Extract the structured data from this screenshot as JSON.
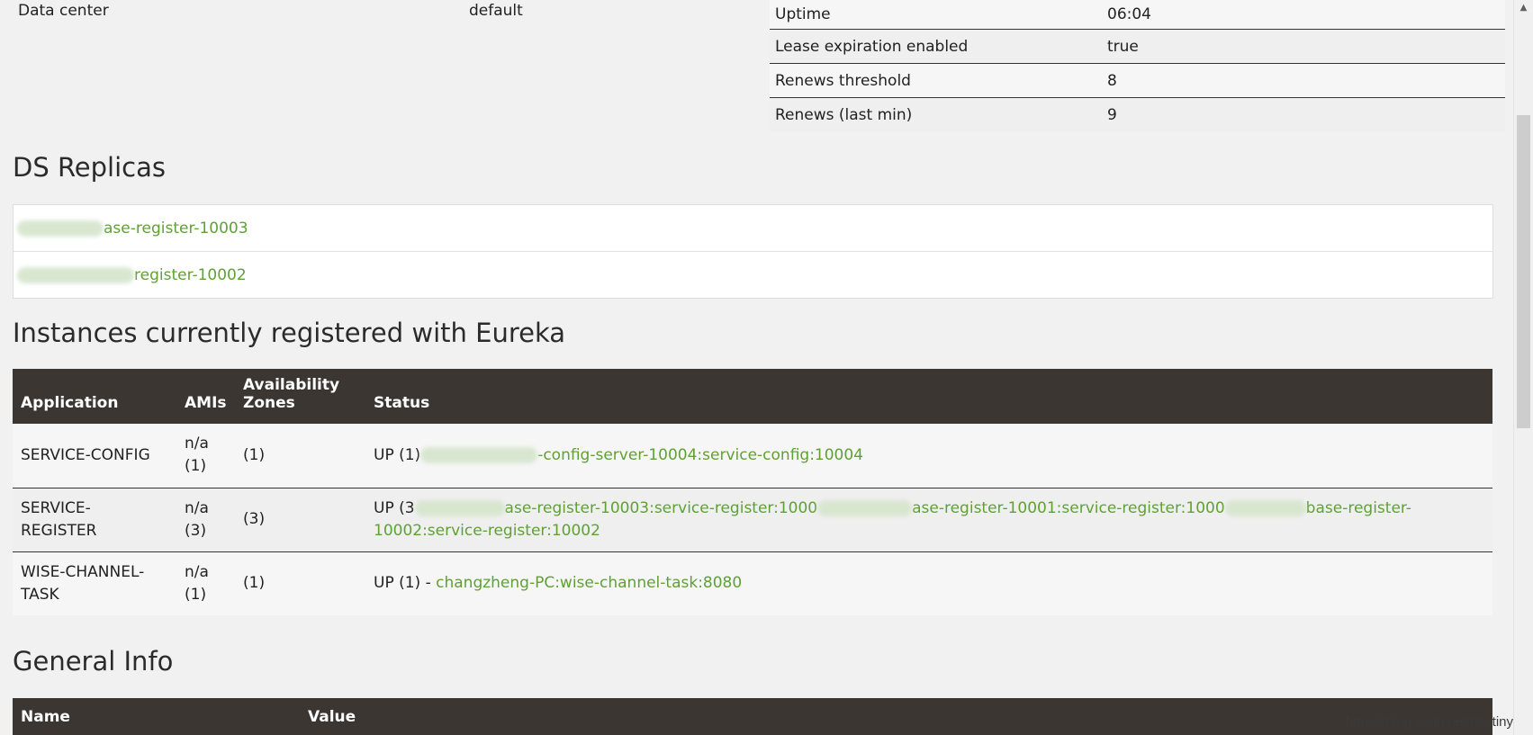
{
  "top_left": {
    "key": "Data center",
    "value": "default"
  },
  "top_right": [
    {
      "key": "Uptime",
      "value": "06:04"
    },
    {
      "key": "Lease expiration enabled",
      "value": "true"
    },
    {
      "key": "Renews threshold",
      "value": "8"
    },
    {
      "key": "Renews (last min)",
      "value": "9"
    }
  ],
  "ds_replicas": {
    "title": "DS Replicas",
    "items": [
      "ase-register-10003",
      "register-10002"
    ]
  },
  "instances": {
    "title": "Instances currently registered with Eureka",
    "headers": [
      "Application",
      "AMIs",
      "Availability Zones",
      "Status"
    ],
    "headers_split": {
      "az_line1": "Availability",
      "az_line2": "Zones"
    },
    "rows": [
      {
        "application": "SERVICE-CONFIG",
        "amis_a": "n/a",
        "amis_b": "(1)",
        "zones": "(1)",
        "status_prefix": "UP (1)",
        "links": [
          "-config-server-10004:service-config:10004"
        ]
      },
      {
        "application": "SERVICE-REGISTER",
        "app_line1": "SERVICE-",
        "app_line2": "REGISTER",
        "amis_a": "n/a",
        "amis_b": "(3)",
        "zones": "(3)",
        "status_prefix": "UP (3",
        "links": [
          "ase-register-10003:service-register:1000",
          "ase-register-10001:service-register:1000",
          "base-register-",
          "10002:service-register:10002"
        ]
      },
      {
        "application": "WISE-CHANNEL-TASK",
        "app_line1": "WISE-CHANNEL-",
        "app_line2": "TASK",
        "amis_a": "n/a",
        "amis_b": "(1)",
        "zones": "(1)",
        "status_prefix": "UP (1) - ",
        "links": [
          "changzheng-PC:wise-channel-task:8080"
        ]
      }
    ]
  },
  "general_info": {
    "title": "General Info",
    "headers": [
      "Name",
      "Value"
    ]
  },
  "watermark": "https://blog.csdn.net/destiny",
  "colors": {
    "link": "#5fa134",
    "header_bg": "#3b3631",
    "page_bg": "#f1f1f1"
  }
}
